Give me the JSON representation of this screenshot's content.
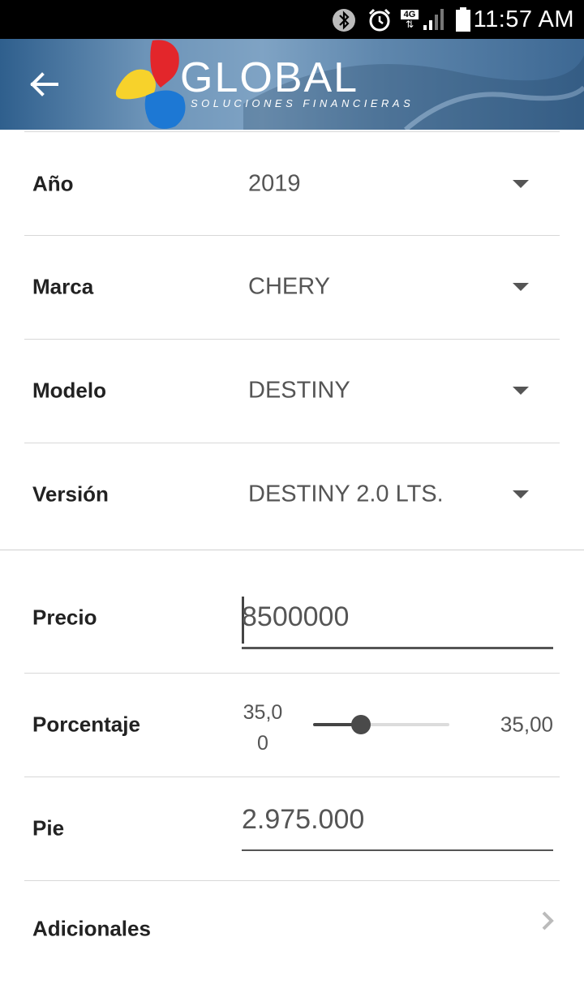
{
  "status_bar": {
    "time": "11:57 AM",
    "network": "4G",
    "icons": [
      "bluetooth-icon",
      "alarm-icon",
      "4g-icon",
      "signal-icon",
      "battery-icon"
    ]
  },
  "header": {
    "brand_title": "GLOBAL",
    "brand_subtitle": "SOLUCIONES FINANCIERAS",
    "back_icon": "back-arrow-icon",
    "logo_colors": [
      "#e3262b",
      "#f7d22b",
      "#1d78d4"
    ]
  },
  "form": {
    "ano": {
      "label": "Año",
      "value": "2019"
    },
    "marca": {
      "label": "Marca",
      "value": "CHERY"
    },
    "modelo": {
      "label": "Modelo",
      "value": "DESTINY"
    },
    "version": {
      "label": "Versión",
      "value": "DESTINY 2.0 LTS."
    },
    "precio": {
      "label": "Precio",
      "value": "8500000"
    },
    "porcentaje": {
      "label": "Porcentaje",
      "min_label": "35,0\n0",
      "max_label": "35,00",
      "slider_fraction": 0.35
    },
    "pie": {
      "label": "Pie",
      "value": "2.975.000"
    },
    "adicionales": {
      "label": "Adicionales"
    }
  }
}
